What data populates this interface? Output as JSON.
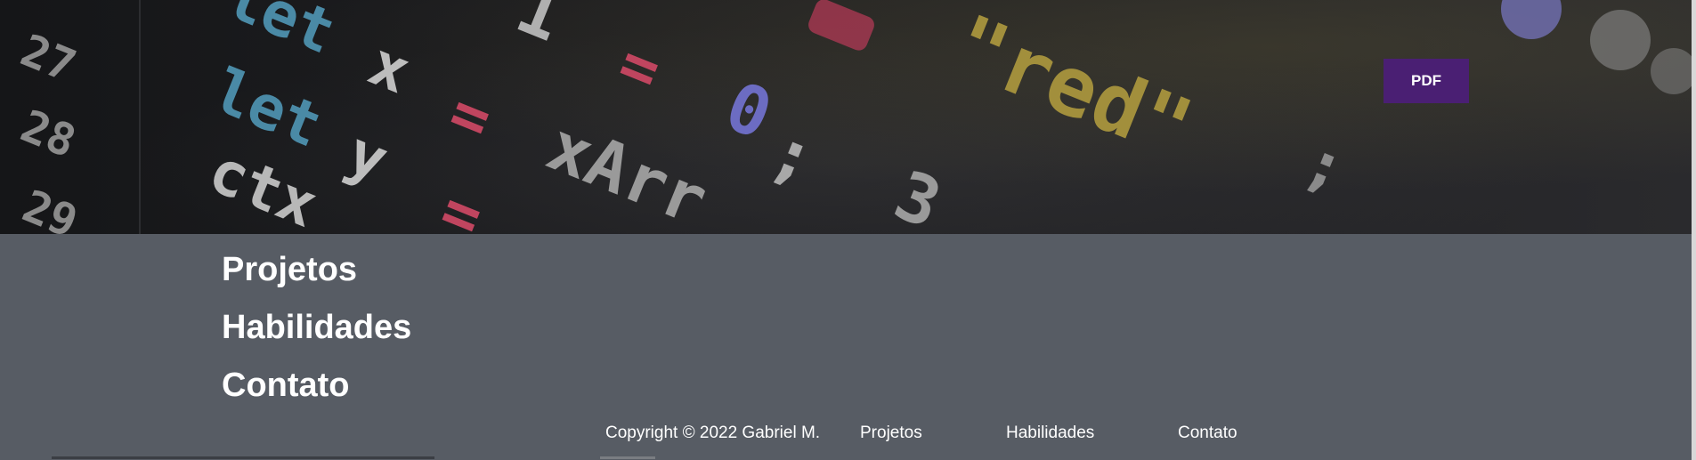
{
  "hero": {
    "pdf_label": "PDF",
    "code_glyphs": [
      "27",
      "28",
      "29",
      "let",
      "let",
      "ctx",
      "x",
      "y",
      "=",
      "=",
      "=",
      "0",
      ";",
      "xArr",
      "\"red\"",
      "1",
      "3",
      ";"
    ]
  },
  "nav": {
    "items": [
      {
        "label": "Projetos"
      },
      {
        "label": "Habilidades"
      },
      {
        "label": "Contato"
      }
    ]
  },
  "footer": {
    "copyright": "Copyright © 2022 Gabriel M.",
    "links": [
      {
        "label": "Projetos"
      },
      {
        "label": "Habilidades"
      },
      {
        "label": "Contato"
      }
    ]
  },
  "colors": {
    "pdf_button": "#4a1f73",
    "content_bg": "#575c64",
    "text": "#ffffff"
  }
}
